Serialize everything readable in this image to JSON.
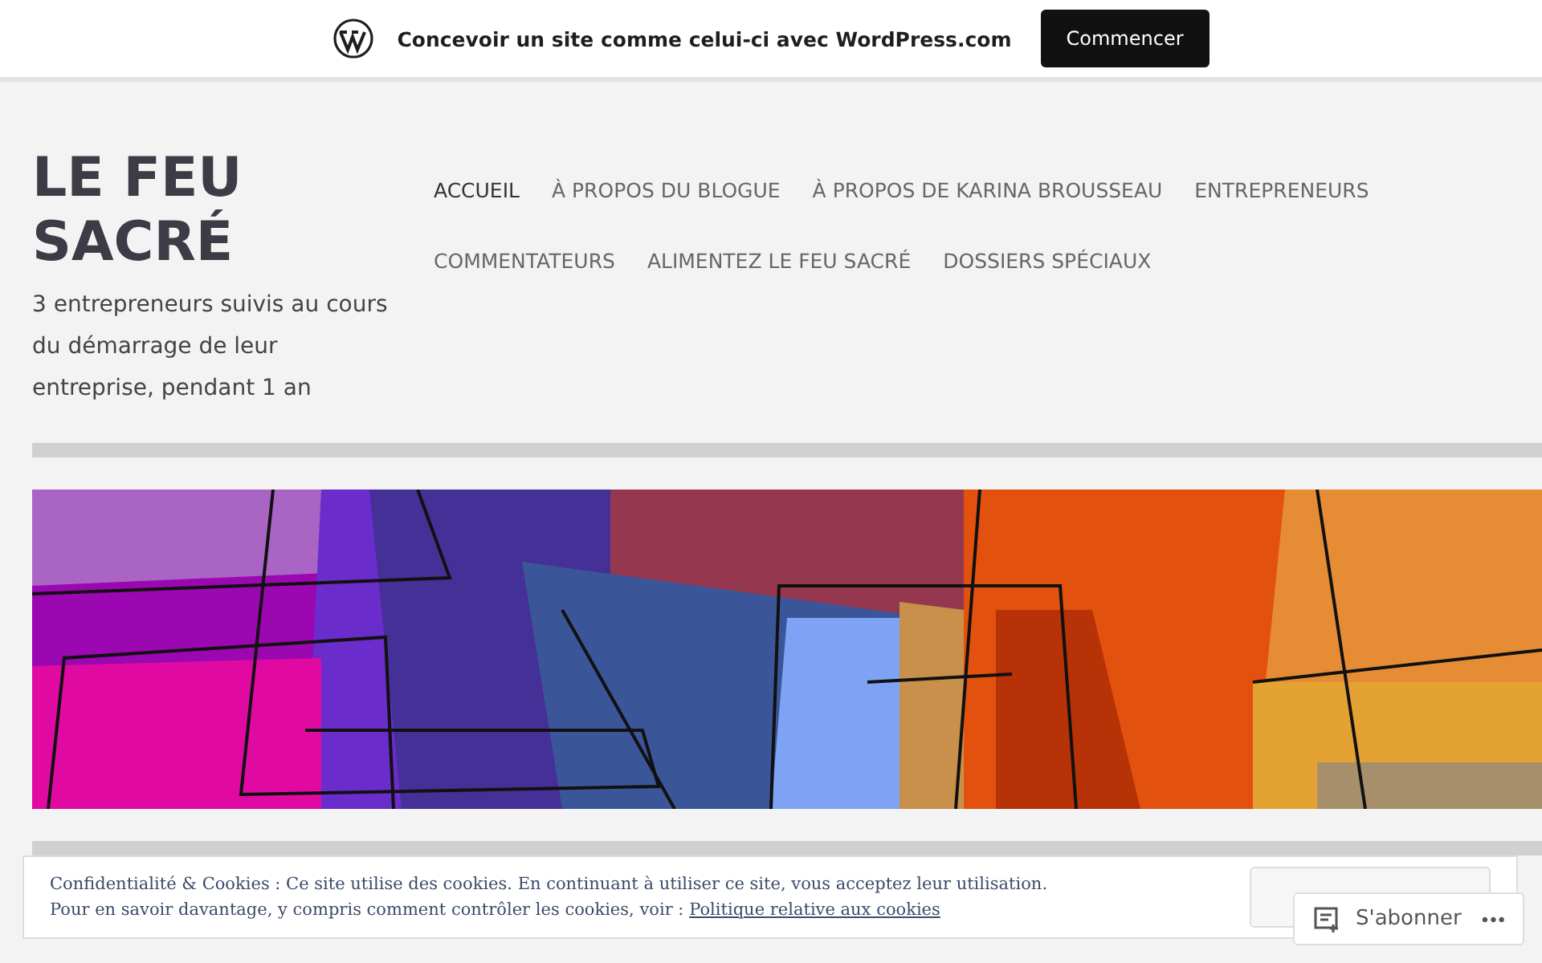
{
  "promo_bar": {
    "text": "Concevoir un site comme celui-ci avec WordPress.com",
    "button": "Commencer"
  },
  "site": {
    "title": "LE FEU SACRÉ",
    "tagline": "3 entrepreneurs suivis au cours du démarrage de leur entreprise, pendant 1 an"
  },
  "nav": [
    {
      "label": "ACCUEIL",
      "selected": true
    },
    {
      "label": "À PROPOS DU BLOGUE",
      "selected": false
    },
    {
      "label": "À PROPOS DE KARINA BROUSSEAU",
      "selected": false
    },
    {
      "label": "ENTREPRENEURS",
      "selected": false
    },
    {
      "label": "COMMENTATEURS",
      "selected": false
    },
    {
      "label": "ALIMENTEZ LE FEU SACRÉ",
      "selected": false
    },
    {
      "label": "DOSSIERS SPÉCIAUX",
      "selected": false
    }
  ],
  "cookie_banner": {
    "line_1": "Confidentialité & Cookies : Ce site utilise des cookies. En continuant à utiliser ce site, vous acceptez leur utilisation.",
    "line_2": "Pour en savoir davantage, y compris comment contrôler les cookies, voir :",
    "link": "Politique relative aux cookies"
  },
  "subscribe": {
    "label": "S'abonner",
    "more": "•••"
  }
}
